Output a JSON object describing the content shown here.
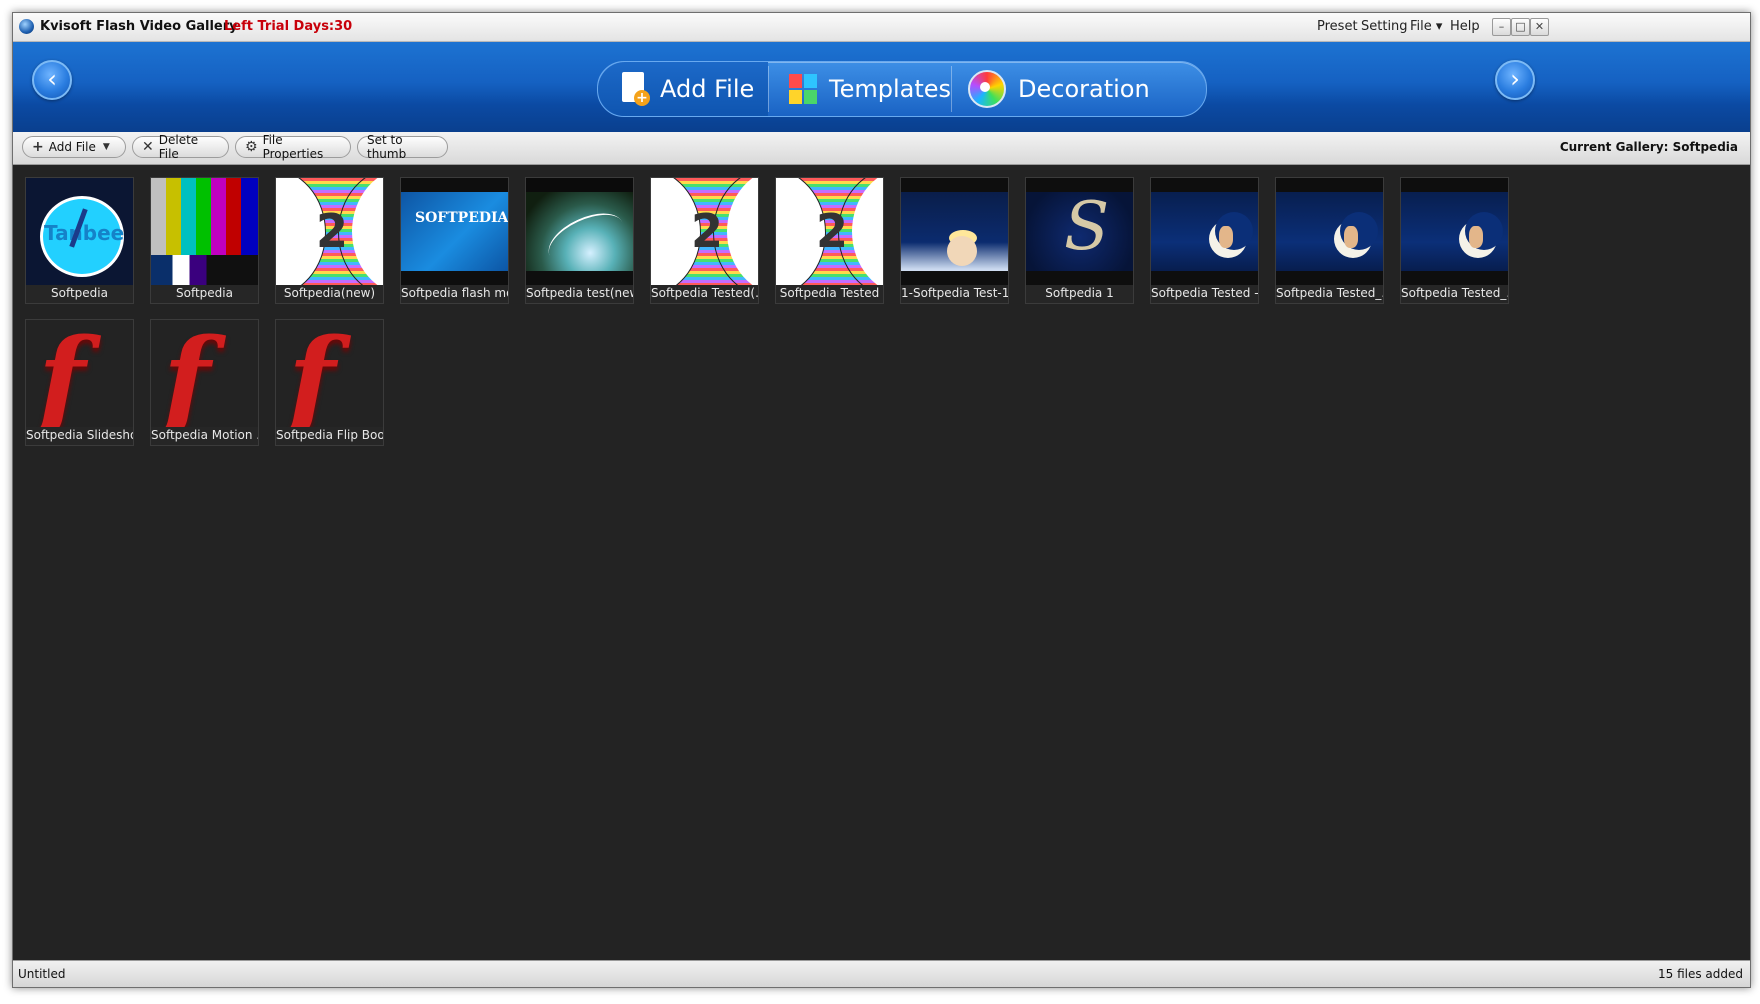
{
  "window": {
    "title": "Kvisoft Flash Video Gallery",
    "trial": "Left Trial Days:30",
    "menu": [
      "Preset",
      "Setting",
      "File ▾",
      "Help"
    ],
    "controls": [
      "–",
      "□",
      "✕"
    ]
  },
  "header": {
    "nav_prev": "‹",
    "nav_next": "›",
    "tabs": [
      {
        "label": "Add File",
        "icon": "add-file-icon",
        "active": true
      },
      {
        "label": "Templates",
        "icon": "templates-icon",
        "active": false
      },
      {
        "label": "Decoration",
        "icon": "decoration-icon",
        "active": false
      }
    ]
  },
  "toolbar": {
    "add_file": "Add File",
    "delete_file": "Delete File",
    "file_properties": "File Properties",
    "set_to_thumb": "Set to thumb",
    "current_gallery": "Current Gallery: Softpedia"
  },
  "files": [
    {
      "name": "Softpedia",
      "thumb": "clock"
    },
    {
      "name": "Softpedia",
      "thumb": "color-bars"
    },
    {
      "name": "Softpedia(new)",
      "thumb": "countdown-stripes"
    },
    {
      "name": "Softpedia flash mo...",
      "thumb": "softpedia-blue"
    },
    {
      "name": "Softpedia test(new)",
      "thumb": "earth"
    },
    {
      "name": "Softpedia Tested(...",
      "thumb": "countdown-stripes"
    },
    {
      "name": "Softpedia Tested",
      "thumb": "countdown-stripes"
    },
    {
      "name": "1-Softpedia Test-1",
      "thumb": "night-portrait"
    },
    {
      "name": "Softpedia 1",
      "thumb": "dark-s"
    },
    {
      "name": "Softpedia Tested -...",
      "thumb": "moon"
    },
    {
      "name": "Softpedia Tested_...",
      "thumb": "moon"
    },
    {
      "name": "Softpedia Tested_...",
      "thumb": "moon"
    },
    {
      "name": "Softpedia Slideshow",
      "thumb": "flash-logo"
    },
    {
      "name": "Softpedia Motion ...",
      "thumb": "flash-logo"
    },
    {
      "name": "Softpedia Flip Book",
      "thumb": "flash-logo"
    }
  ],
  "status": {
    "left": "Untitled",
    "right": "15 files added"
  },
  "colors": {
    "header_blue": "#1561c2",
    "trial_red": "#c8000a",
    "content_bg": "#232323",
    "flash_red": "#d21e1e"
  }
}
